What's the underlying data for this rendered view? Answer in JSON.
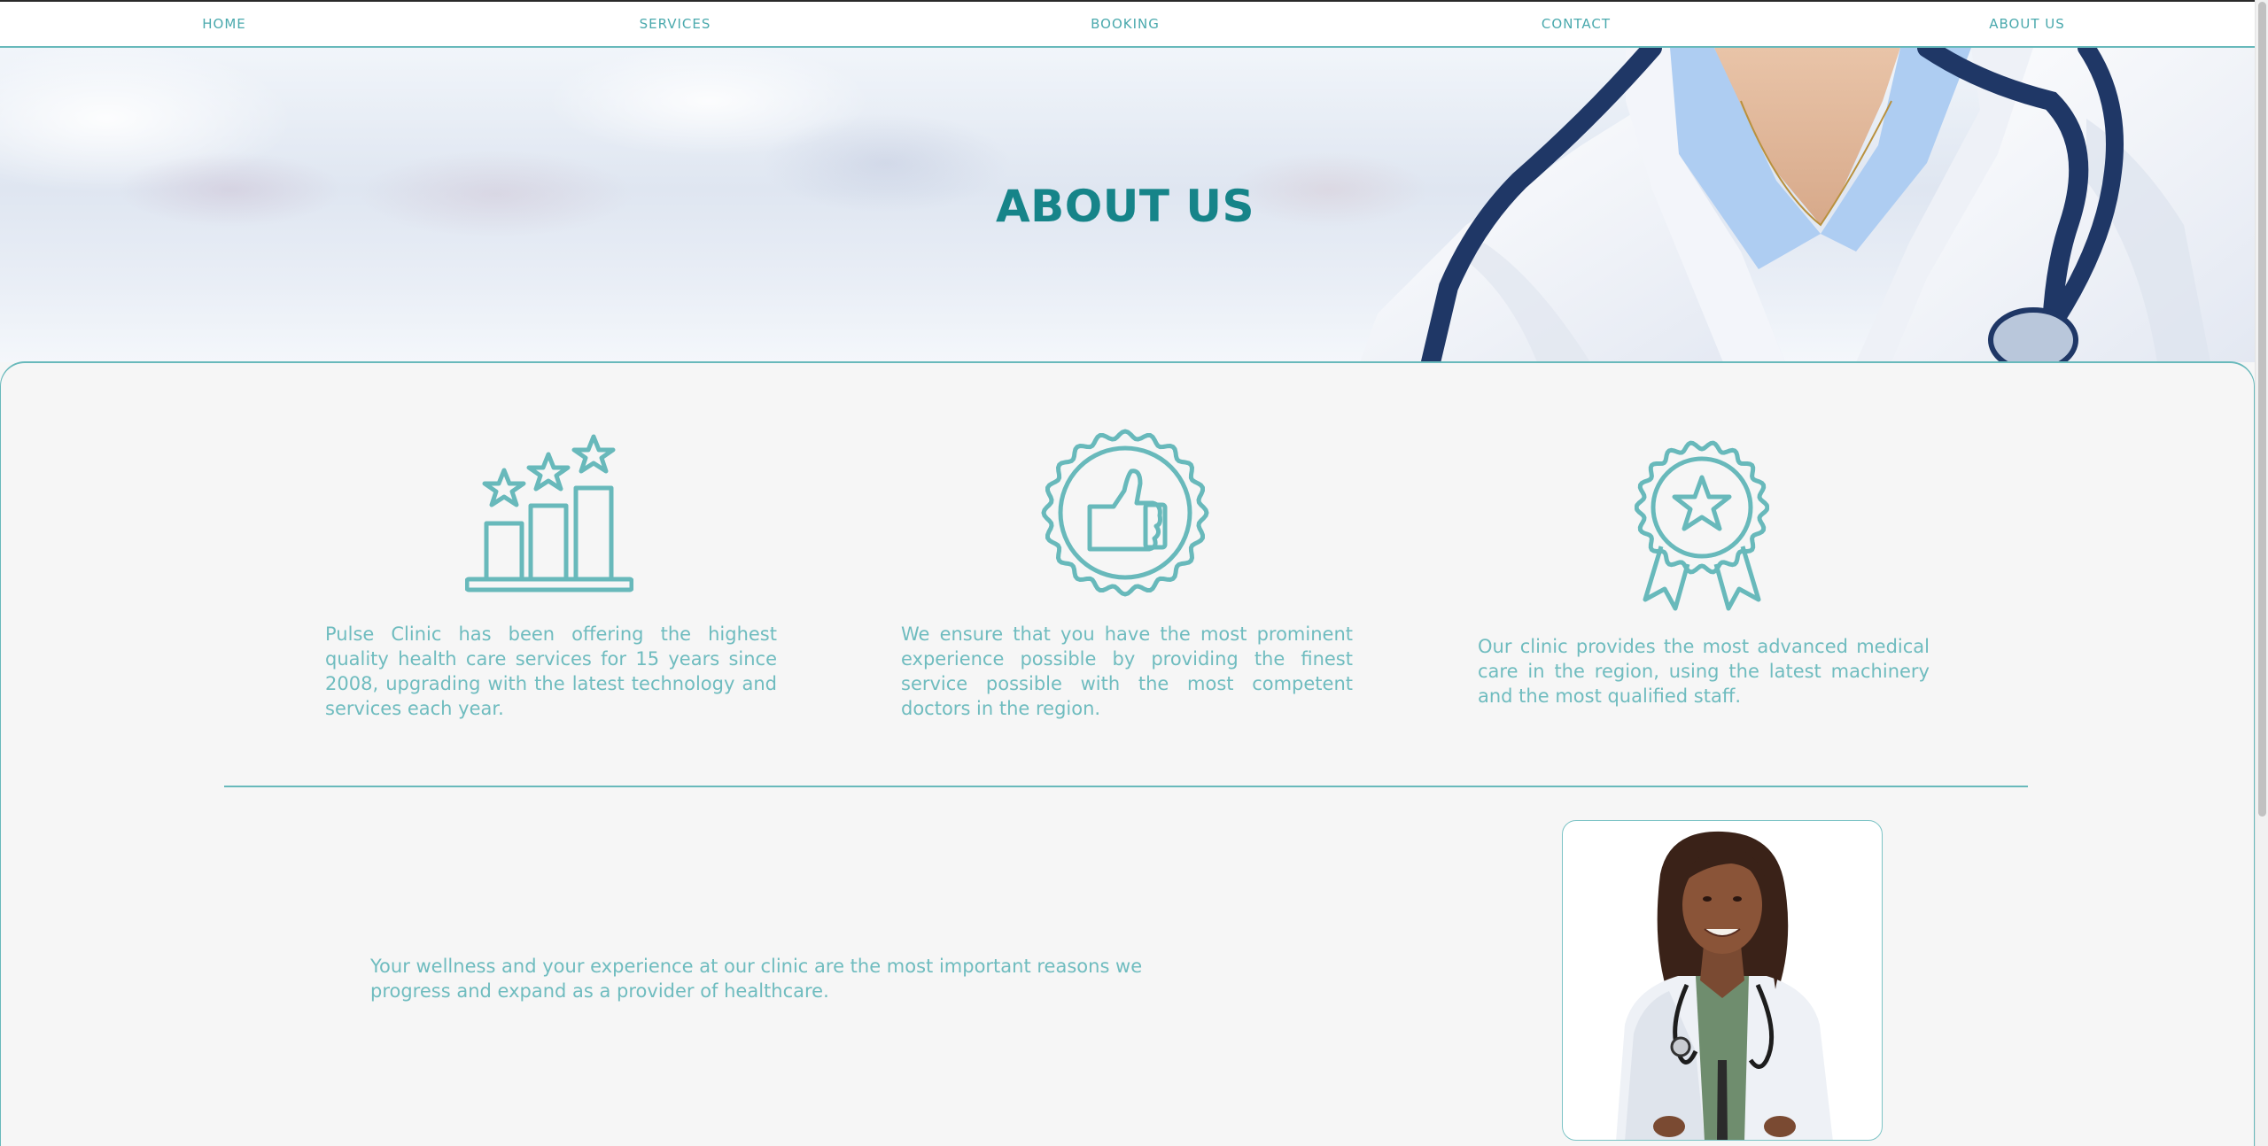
{
  "nav": {
    "items": [
      {
        "label": "HOME"
      },
      {
        "label": "SERVICES"
      },
      {
        "label": "BOOKING"
      },
      {
        "label": "CONTACT"
      },
      {
        "label": "ABOUT US"
      }
    ]
  },
  "hero": {
    "title": "ABOUT US"
  },
  "features": [
    {
      "icon": "rating-bar-chart-icon",
      "text": "Pulse Clinic has been offering the highest quality health care services for 15 years since 2008, upgrading with the latest technology and services each year."
    },
    {
      "icon": "thumbs-up-badge-icon",
      "text": "We ensure that you have the most prominent experience possible by providing the finest service possible with the most competent doctors in the region."
    },
    {
      "icon": "award-ribbon-icon",
      "text": "Our clinic provides the most advanced medical care in the region, using the latest machinery and the most qualified staff."
    }
  ],
  "wellness": {
    "text": "Your wellness and your experience at our clinic are the most important reasons we progress and expand as a provider of healthcare."
  },
  "colors": {
    "accent": "#68b9bb",
    "title": "#168489",
    "text": "#6fbcbf",
    "background": "#f6f6f6"
  }
}
